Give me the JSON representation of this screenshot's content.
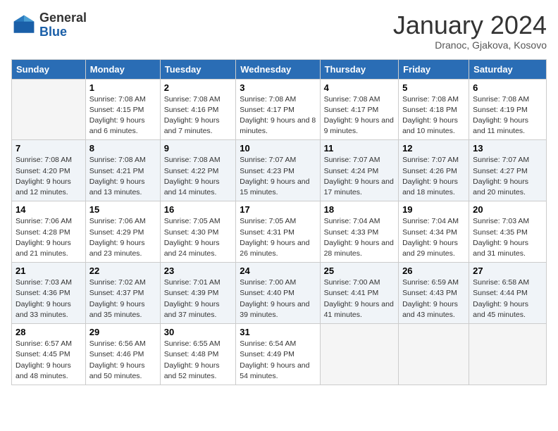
{
  "header": {
    "logo_general": "General",
    "logo_blue": "Blue",
    "month_title": "January 2024",
    "subtitle": "Dranoc, Gjakova, Kosovo"
  },
  "days_of_week": [
    "Sunday",
    "Monday",
    "Tuesday",
    "Wednesday",
    "Thursday",
    "Friday",
    "Saturday"
  ],
  "weeks": [
    [
      {
        "day": "",
        "empty": true
      },
      {
        "day": "1",
        "sunrise": "Sunrise: 7:08 AM",
        "sunset": "Sunset: 4:15 PM",
        "daylight": "Daylight: 9 hours and 6 minutes."
      },
      {
        "day": "2",
        "sunrise": "Sunrise: 7:08 AM",
        "sunset": "Sunset: 4:16 PM",
        "daylight": "Daylight: 9 hours and 7 minutes."
      },
      {
        "day": "3",
        "sunrise": "Sunrise: 7:08 AM",
        "sunset": "Sunset: 4:17 PM",
        "daylight": "Daylight: 9 hours and 8 minutes."
      },
      {
        "day": "4",
        "sunrise": "Sunrise: 7:08 AM",
        "sunset": "Sunset: 4:17 PM",
        "daylight": "Daylight: 9 hours and 9 minutes."
      },
      {
        "day": "5",
        "sunrise": "Sunrise: 7:08 AM",
        "sunset": "Sunset: 4:18 PM",
        "daylight": "Daylight: 9 hours and 10 minutes."
      },
      {
        "day": "6",
        "sunrise": "Sunrise: 7:08 AM",
        "sunset": "Sunset: 4:19 PM",
        "daylight": "Daylight: 9 hours and 11 minutes."
      }
    ],
    [
      {
        "day": "7",
        "sunrise": "Sunrise: 7:08 AM",
        "sunset": "Sunset: 4:20 PM",
        "daylight": "Daylight: 9 hours and 12 minutes."
      },
      {
        "day": "8",
        "sunrise": "Sunrise: 7:08 AM",
        "sunset": "Sunset: 4:21 PM",
        "daylight": "Daylight: 9 hours and 13 minutes."
      },
      {
        "day": "9",
        "sunrise": "Sunrise: 7:08 AM",
        "sunset": "Sunset: 4:22 PM",
        "daylight": "Daylight: 9 hours and 14 minutes."
      },
      {
        "day": "10",
        "sunrise": "Sunrise: 7:07 AM",
        "sunset": "Sunset: 4:23 PM",
        "daylight": "Daylight: 9 hours and 15 minutes."
      },
      {
        "day": "11",
        "sunrise": "Sunrise: 7:07 AM",
        "sunset": "Sunset: 4:24 PM",
        "daylight": "Daylight: 9 hours and 17 minutes."
      },
      {
        "day": "12",
        "sunrise": "Sunrise: 7:07 AM",
        "sunset": "Sunset: 4:26 PM",
        "daylight": "Daylight: 9 hours and 18 minutes."
      },
      {
        "day": "13",
        "sunrise": "Sunrise: 7:07 AM",
        "sunset": "Sunset: 4:27 PM",
        "daylight": "Daylight: 9 hours and 20 minutes."
      }
    ],
    [
      {
        "day": "14",
        "sunrise": "Sunrise: 7:06 AM",
        "sunset": "Sunset: 4:28 PM",
        "daylight": "Daylight: 9 hours and 21 minutes."
      },
      {
        "day": "15",
        "sunrise": "Sunrise: 7:06 AM",
        "sunset": "Sunset: 4:29 PM",
        "daylight": "Daylight: 9 hours and 23 minutes."
      },
      {
        "day": "16",
        "sunrise": "Sunrise: 7:05 AM",
        "sunset": "Sunset: 4:30 PM",
        "daylight": "Daylight: 9 hours and 24 minutes."
      },
      {
        "day": "17",
        "sunrise": "Sunrise: 7:05 AM",
        "sunset": "Sunset: 4:31 PM",
        "daylight": "Daylight: 9 hours and 26 minutes."
      },
      {
        "day": "18",
        "sunrise": "Sunrise: 7:04 AM",
        "sunset": "Sunset: 4:33 PM",
        "daylight": "Daylight: 9 hours and 28 minutes."
      },
      {
        "day": "19",
        "sunrise": "Sunrise: 7:04 AM",
        "sunset": "Sunset: 4:34 PM",
        "daylight": "Daylight: 9 hours and 29 minutes."
      },
      {
        "day": "20",
        "sunrise": "Sunrise: 7:03 AM",
        "sunset": "Sunset: 4:35 PM",
        "daylight": "Daylight: 9 hours and 31 minutes."
      }
    ],
    [
      {
        "day": "21",
        "sunrise": "Sunrise: 7:03 AM",
        "sunset": "Sunset: 4:36 PM",
        "daylight": "Daylight: 9 hours and 33 minutes."
      },
      {
        "day": "22",
        "sunrise": "Sunrise: 7:02 AM",
        "sunset": "Sunset: 4:37 PM",
        "daylight": "Daylight: 9 hours and 35 minutes."
      },
      {
        "day": "23",
        "sunrise": "Sunrise: 7:01 AM",
        "sunset": "Sunset: 4:39 PM",
        "daylight": "Daylight: 9 hours and 37 minutes."
      },
      {
        "day": "24",
        "sunrise": "Sunrise: 7:00 AM",
        "sunset": "Sunset: 4:40 PM",
        "daylight": "Daylight: 9 hours and 39 minutes."
      },
      {
        "day": "25",
        "sunrise": "Sunrise: 7:00 AM",
        "sunset": "Sunset: 4:41 PM",
        "daylight": "Daylight: 9 hours and 41 minutes."
      },
      {
        "day": "26",
        "sunrise": "Sunrise: 6:59 AM",
        "sunset": "Sunset: 4:43 PM",
        "daylight": "Daylight: 9 hours and 43 minutes."
      },
      {
        "day": "27",
        "sunrise": "Sunrise: 6:58 AM",
        "sunset": "Sunset: 4:44 PM",
        "daylight": "Daylight: 9 hours and 45 minutes."
      }
    ],
    [
      {
        "day": "28",
        "sunrise": "Sunrise: 6:57 AM",
        "sunset": "Sunset: 4:45 PM",
        "daylight": "Daylight: 9 hours and 48 minutes."
      },
      {
        "day": "29",
        "sunrise": "Sunrise: 6:56 AM",
        "sunset": "Sunset: 4:46 PM",
        "daylight": "Daylight: 9 hours and 50 minutes."
      },
      {
        "day": "30",
        "sunrise": "Sunrise: 6:55 AM",
        "sunset": "Sunset: 4:48 PM",
        "daylight": "Daylight: 9 hours and 52 minutes."
      },
      {
        "day": "31",
        "sunrise": "Sunrise: 6:54 AM",
        "sunset": "Sunset: 4:49 PM",
        "daylight": "Daylight: 9 hours and 54 minutes."
      },
      {
        "day": "",
        "empty": true
      },
      {
        "day": "",
        "empty": true
      },
      {
        "day": "",
        "empty": true
      }
    ]
  ]
}
